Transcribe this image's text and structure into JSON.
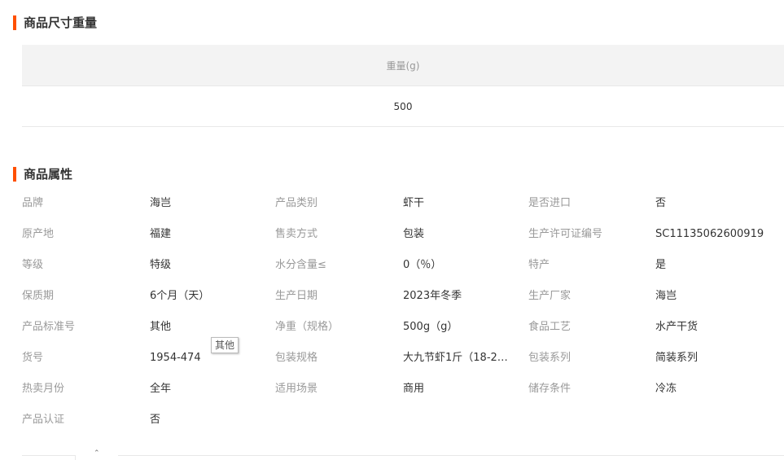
{
  "size_section": {
    "title": "商品尺寸重量",
    "column_header": "重量(g)",
    "value": "500"
  },
  "attr_section": {
    "title": "商品属性",
    "rows": [
      [
        [
          "品牌",
          "海岂"
        ],
        [
          "产品类别",
          "虾干"
        ],
        [
          "是否进口",
          "否"
        ]
      ],
      [
        [
          "原产地",
          "福建"
        ],
        [
          "售卖方式",
          "包装"
        ],
        [
          "生产许可证编号",
          "SC11135062600919"
        ]
      ],
      [
        [
          "等级",
          "特级"
        ],
        [
          "水分含量≤",
          "0（％）"
        ],
        [
          "特产",
          "是"
        ]
      ],
      [
        [
          "保质期",
          "6个月（天）"
        ],
        [
          "生产日期",
          "2023年冬季"
        ],
        [
          "生产厂家",
          "海岂"
        ]
      ],
      [
        [
          "产品标准号",
          "其他"
        ],
        [
          "净重（规格）",
          "500g（g）"
        ],
        [
          "食品工艺",
          "水产干货"
        ]
      ],
      [
        [
          "货号",
          "1954-474"
        ],
        [
          "包装规格",
          "大九节虾1斤（18-22..."
        ],
        [
          "包装系列",
          "简装系列"
        ]
      ],
      [
        [
          "热卖月份",
          "全年"
        ],
        [
          "适用场景",
          "商用"
        ],
        [
          "储存条件",
          "冷冻"
        ]
      ],
      [
        [
          "产品认证",
          "否"
        ]
      ]
    ]
  },
  "tooltip": {
    "text": "其他"
  },
  "bottom": {
    "caret": "⌃"
  }
}
